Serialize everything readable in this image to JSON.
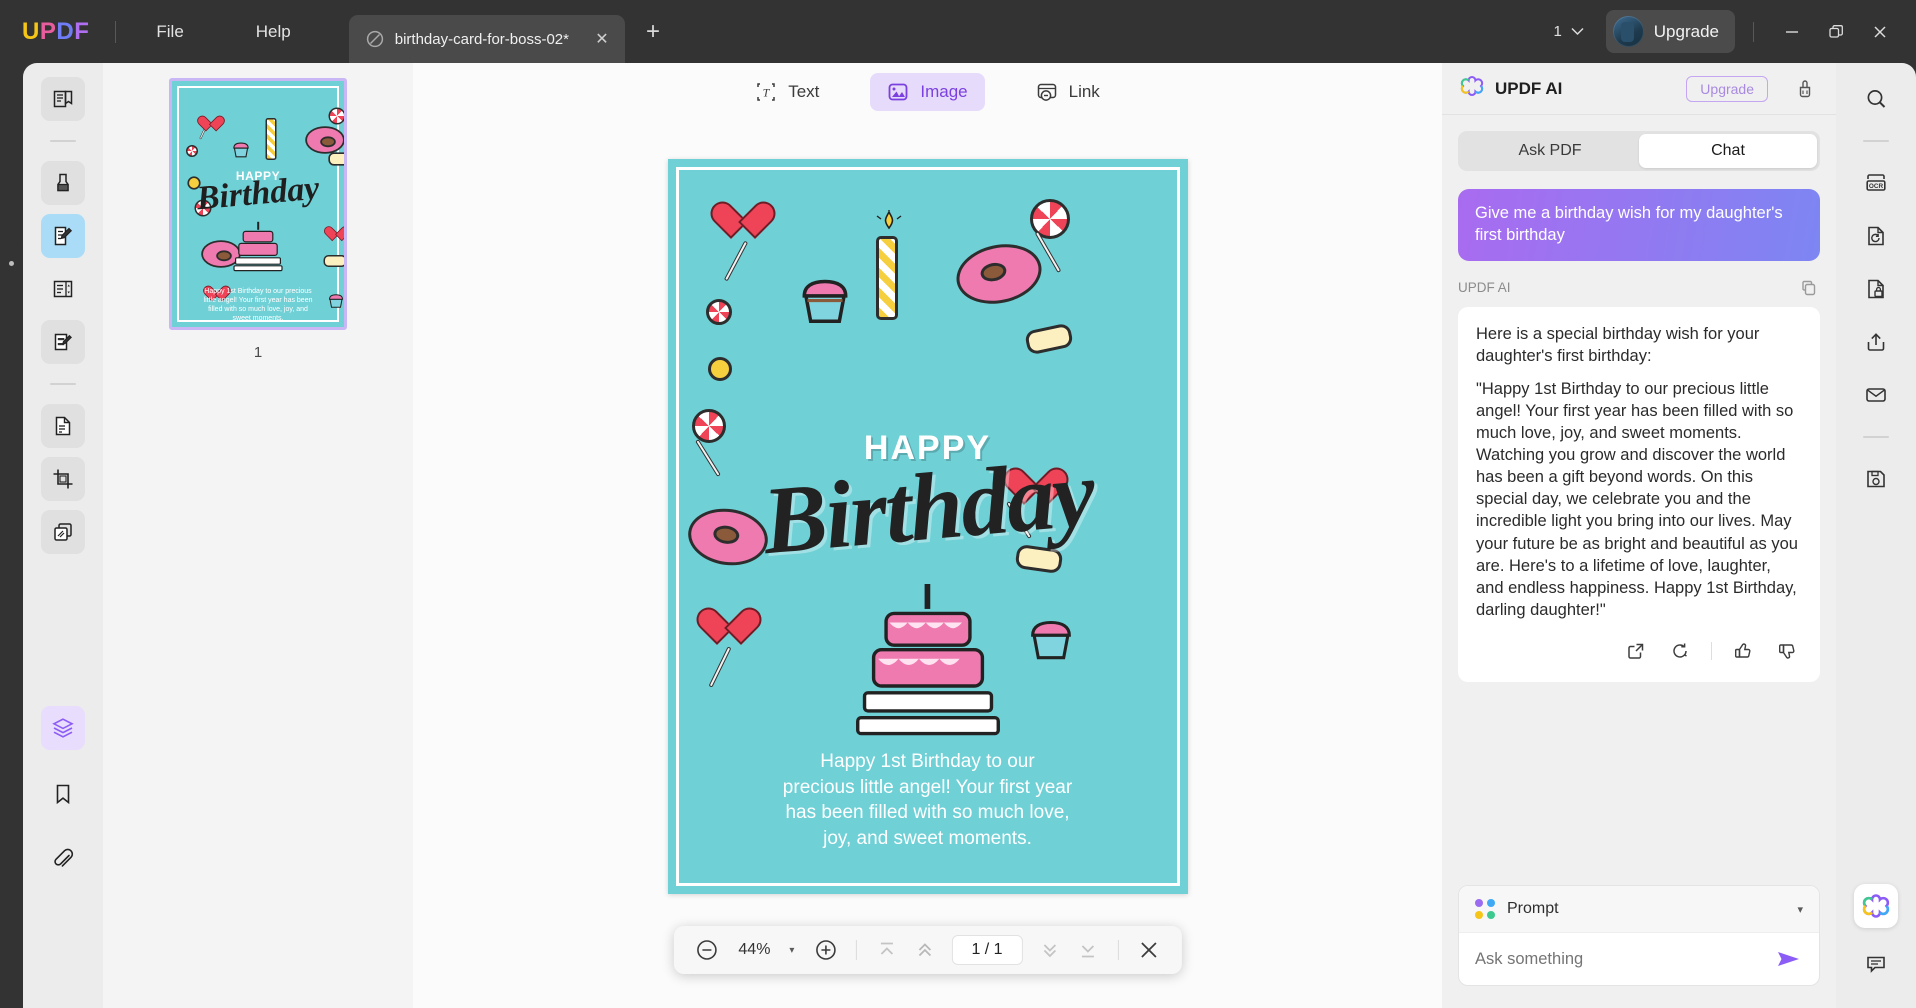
{
  "titlebar": {
    "logo": [
      "U",
      "P",
      "D",
      "F"
    ],
    "menus": [
      {
        "label": "File"
      },
      {
        "label": "Help"
      }
    ],
    "tab": {
      "name": "birthday-card-for-boss-02*",
      "close": "✕",
      "icon": "file-slash-icon"
    },
    "new_tab": "+",
    "page_counter": "1",
    "page_counter_caret": "⌄",
    "upgrade": "Upgrade",
    "window": {
      "minimize": "—",
      "maximize": "❐",
      "close": "✕"
    }
  },
  "left_rail": {
    "items": [
      {
        "name": "reader-view",
        "state": "shaded"
      },
      {
        "name": "annotate-highlighter",
        "state": "shaded"
      },
      {
        "name": "edit-pdf",
        "state": "active"
      },
      {
        "name": "organize-pages",
        "state": "plain"
      },
      {
        "name": "fill-and-sign",
        "state": "shaded"
      },
      {
        "name": "convert-pdf",
        "state": "shaded"
      },
      {
        "name": "crop-page",
        "state": "shaded"
      },
      {
        "name": "batch-process",
        "state": "shaded"
      }
    ],
    "bottom_items": [
      {
        "name": "layers",
        "state": "purple"
      },
      {
        "name": "bookmarks",
        "state": "plain"
      },
      {
        "name": "attachments",
        "state": "plain"
      }
    ]
  },
  "thumbnails": {
    "pages": [
      {
        "label": "1",
        "selected": true
      }
    ]
  },
  "modebar": {
    "items": [
      {
        "label": "Text",
        "icon": "text-tool-icon",
        "active": false
      },
      {
        "label": "Image",
        "icon": "image-tool-icon",
        "active": true
      },
      {
        "label": "Link",
        "icon": "link-tool-icon",
        "active": false
      }
    ]
  },
  "card": {
    "bg_color": "#6fd0d6",
    "heading_small": "HAPPY",
    "heading_big": "Birthday",
    "message": "Happy 1st Birthday to our precious little angel! Your first year has been filled with so much love, joy, and sweet moments."
  },
  "zoombar": {
    "zoom_out": "−",
    "zoom_value": "44%",
    "zoom_caret": "▾",
    "zoom_in": "+",
    "first_page": "first-page-icon",
    "prev_page": "prev-page-icon",
    "page_indicator": "1 / 1",
    "next_page": "next-page-icon",
    "last_page": "last-page-icon",
    "close": "✕"
  },
  "ai_panel": {
    "title": "UPDF AI",
    "upgrade": "Upgrade",
    "clean_icon": "brush-icon",
    "tabs": [
      {
        "label": "Ask PDF",
        "active": false
      },
      {
        "label": "Chat",
        "active": true
      }
    ],
    "user_message": "Give me a birthday wish for my daughter's first birthday",
    "assistant_label": "UPDF AI",
    "copy_icon": "copy-icon",
    "assistant_paragraphs": [
      "Here is a special birthday wish for your daughter's first birthday:",
      "\"Happy 1st Birthday to our precious little angel! Your first year has been filled with so much love, joy, and sweet moments. Watching you grow and discover the world has been a gift beyond words. On this special day, we celebrate you and the incredible light you bring into our lives. May your future be as bright and beautiful as you are. Here's to a lifetime of love, laughter, and endless happiness. Happy 1st Birthday, darling daughter!\""
    ],
    "actions": [
      {
        "name": "open-external-icon"
      },
      {
        "name": "regenerate-icon"
      },
      {
        "name": "thumbs-up-icon"
      },
      {
        "name": "thumbs-down-icon"
      }
    ],
    "prompt_label": "Prompt",
    "prompt_caret": "▾",
    "ask_placeholder": "Ask something",
    "send_icon": "send-icon",
    "dot_colors": [
      "#9b6cf0",
      "#3fa9f5",
      "#f5c518",
      "#3ec98f"
    ],
    "accent": "#8b5cf6",
    "bubble_gradient": [
      "#a96bf0",
      "#7d86f2"
    ]
  },
  "right_rail": {
    "items": [
      {
        "name": "search"
      },
      {
        "name": "ocr"
      },
      {
        "name": "convert"
      },
      {
        "name": "protect"
      },
      {
        "name": "share"
      },
      {
        "name": "email"
      },
      {
        "name": "save-as"
      }
    ],
    "bottom_items": [
      {
        "name": "updf-ai"
      },
      {
        "name": "comment"
      }
    ]
  }
}
